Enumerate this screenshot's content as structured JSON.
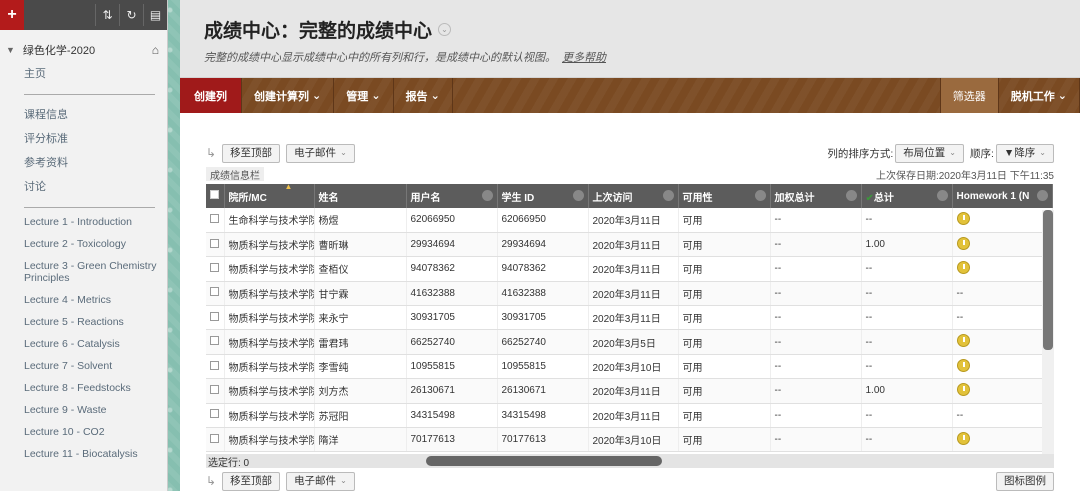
{
  "sidebar": {
    "add_label": "+",
    "course": "绿色化学-2020",
    "items": [
      "主页",
      "课程信息",
      "评分标准",
      "参考资料",
      "讨论"
    ],
    "lectures": [
      "Lecture 1 - Introduction",
      "Lecture 2 - Toxicology",
      "Lecture 3 - Green Chemistry Principles",
      "Lecture 4 - Metrics",
      "Lecture 5 - Reactions",
      "Lecture 6 - Catalysis",
      "Lecture 7 - Solvent",
      "Lecture 8 - Feedstocks",
      "Lecture 9 - Waste",
      "Lecture 10 - CO2",
      "Lecture 11 - Biocatalysis"
    ]
  },
  "header": {
    "title": "成绩中心：完整的成绩中心",
    "description": "完整的成绩中心显示成绩中心中的所有列和行，是成绩中心的默认视图。",
    "help_link": "更多帮助"
  },
  "actionbar": {
    "create_column": "创建列",
    "create_calc": "创建计算列",
    "manage": "管理",
    "reports": "报告",
    "filter": "筛选器",
    "offline": "脱机工作"
  },
  "toolbar": {
    "move_top": "移至顶部",
    "email": "电子邮件",
    "sort_label": "列的排序方式:",
    "sort_value": "布局位置",
    "order_label": "顺序:",
    "order_value": "▼降序"
  },
  "info": {
    "tab": "成绩信息栏",
    "last_saved": "上次保存日期:2020年3月11日 下午11:35"
  },
  "table": {
    "headers": [
      "院所/MC",
      "姓名",
      "用户名",
      "学生 ID",
      "上次访问",
      "可用性",
      "加权总计",
      "总计",
      "Homework 1 (N"
    ],
    "rows": [
      {
        "dept": "生命科学与技术学院",
        "name": "杨煜",
        "user": "62066950",
        "sid": "62066950",
        "last": "2020年3月11日",
        "avail": "可用",
        "weighted": "--",
        "total": "--",
        "hw": "gold"
      },
      {
        "dept": "物质科学与技术学院",
        "name": "曹昕琳",
        "user": "29934694",
        "sid": "29934694",
        "last": "2020年3月11日",
        "avail": "可用",
        "weighted": "--",
        "total": "1.00",
        "hw": "gold"
      },
      {
        "dept": "物质科学与技术学院",
        "name": "查栢仪",
        "user": "94078362",
        "sid": "94078362",
        "last": "2020年3月11日",
        "avail": "可用",
        "weighted": "--",
        "total": "--",
        "hw": "gold"
      },
      {
        "dept": "物质科学与技术学院",
        "name": "甘宁霖",
        "user": "41632388",
        "sid": "41632388",
        "last": "2020年3月11日",
        "avail": "可用",
        "weighted": "--",
        "total": "--",
        "hw": "--"
      },
      {
        "dept": "物质科学与技术学院",
        "name": "来永宁",
        "user": "30931705",
        "sid": "30931705",
        "last": "2020年3月11日",
        "avail": "可用",
        "weighted": "--",
        "total": "--",
        "hw": "--"
      },
      {
        "dept": "物质科学与技术学院",
        "name": "雷君玮",
        "user": "66252740",
        "sid": "66252740",
        "last": "2020年3月5日",
        "avail": "可用",
        "weighted": "--",
        "total": "--",
        "hw": "gold"
      },
      {
        "dept": "物质科学与技术学院",
        "name": "李雪纯",
        "user": "10955815",
        "sid": "10955815",
        "last": "2020年3月10日",
        "avail": "可用",
        "weighted": "--",
        "total": "--",
        "hw": "gold"
      },
      {
        "dept": "物质科学与技术学院",
        "name": "刘方杰",
        "user": "26130671",
        "sid": "26130671",
        "last": "2020年3月11日",
        "avail": "可用",
        "weighted": "--",
        "total": "1.00",
        "hw": "gold"
      },
      {
        "dept": "物质科学与技术学院",
        "name": "苏冠阳",
        "user": "34315498",
        "sid": "34315498",
        "last": "2020年3月11日",
        "avail": "可用",
        "weighted": "--",
        "total": "--",
        "hw": "--"
      },
      {
        "dept": "物质科学与技术学院",
        "name": "隋洋",
        "user": "70177613",
        "sid": "70177613",
        "last": "2020年3月10日",
        "avail": "可用",
        "weighted": "--",
        "total": "--",
        "hw": "gold"
      }
    ]
  },
  "footer": {
    "selected": "选定行: 0",
    "legend": "图标图例"
  }
}
